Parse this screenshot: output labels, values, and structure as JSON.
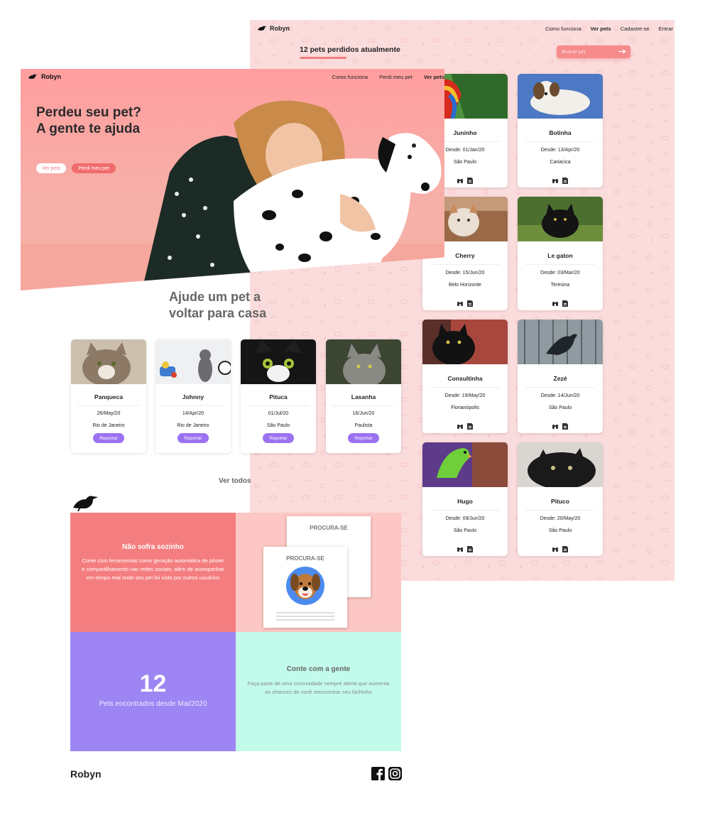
{
  "back_page": {
    "logo": "Robyn",
    "nav": [
      "Como funciona",
      "Ver pets",
      "Cadastre-se",
      "Entrar"
    ],
    "nav_active": "Ver pets",
    "count_text": "12 pets perdidos atualmente",
    "search_placeholder": "Buscar pet",
    "pets": [
      {
        "name": "Juninho",
        "since": "Desde: 01/Jan/20",
        "city": "São Paulo"
      },
      {
        "name": "Bolinha",
        "since": "Desde: 13/Apr/20",
        "city": "Cariacica"
      },
      {
        "name": "Cherry",
        "since": "Desde: 15/Jun/20",
        "city": "Belo Horizonte"
      },
      {
        "name": "Le gaton",
        "since": "Desde: 03/Mar/20",
        "city": "Teresina"
      },
      {
        "name": "Consultinha",
        "since": "Desde: 19/May/20",
        "city": "Florianópolis"
      },
      {
        "name": "Zezé",
        "since": "Desde: 14/Jun/20",
        "city": "São Paulo"
      },
      {
        "name": "Hugo",
        "since": "Desde: 09/Jun/20",
        "city": "São Paulo"
      },
      {
        "name": "Pituco",
        "since": "Desde: 20/May/20",
        "city": "São Paulo"
      }
    ]
  },
  "front_page": {
    "logo": "Robyn",
    "nav": [
      "Como funciona",
      "Perdi meu pet",
      "Ver pets"
    ],
    "nav_active": "Ver pets",
    "hero_title": "Perdeu seu pet? A gente te ajuda",
    "btn_see_pets": "Ver pets",
    "btn_lost_pet": "Perdi meu pet",
    "help_title": "Ajude um pet a voltar para casa",
    "found_pets": [
      {
        "name": "Panqueca",
        "date": "26/May/20",
        "city": "Rio de Janeiro"
      },
      {
        "name": "Johnny",
        "date": "14/Apr/20",
        "city": "Rio de Janeiro"
      },
      {
        "name": "Pituca",
        "date": "01/Jul/20",
        "city": "São Paulo"
      },
      {
        "name": "Lasanha",
        "date": "16/Jun/20",
        "city": "Paulista"
      }
    ],
    "report_label": "Reportar",
    "see_all": "Ver todos",
    "feature1_title": "Não sofra sozinho",
    "feature1_text": "Conte com ferramentas como geração automática de pôster e compartilhamento nas redes sociais, além de acompanhar em tempo real onde seu pet foi visto por outros usuários",
    "poster_label": "PROCURA-SE",
    "stat_number": "12",
    "stat_label": "Pets encontrados desde Mai/2020",
    "feature2_title": "Conte com a gente",
    "feature2_text": "Faça parte de uma comunidade sempre alerta que aumenta as chances de você reencontrar seu bichinho",
    "footer_logo": "Robyn"
  },
  "colors": {
    "coral": "#f47e7f",
    "light_pink": "#fcc7c4",
    "purple": "#9d85f3",
    "mint": "#c3fbeb",
    "report_button": "#9b72f2"
  }
}
